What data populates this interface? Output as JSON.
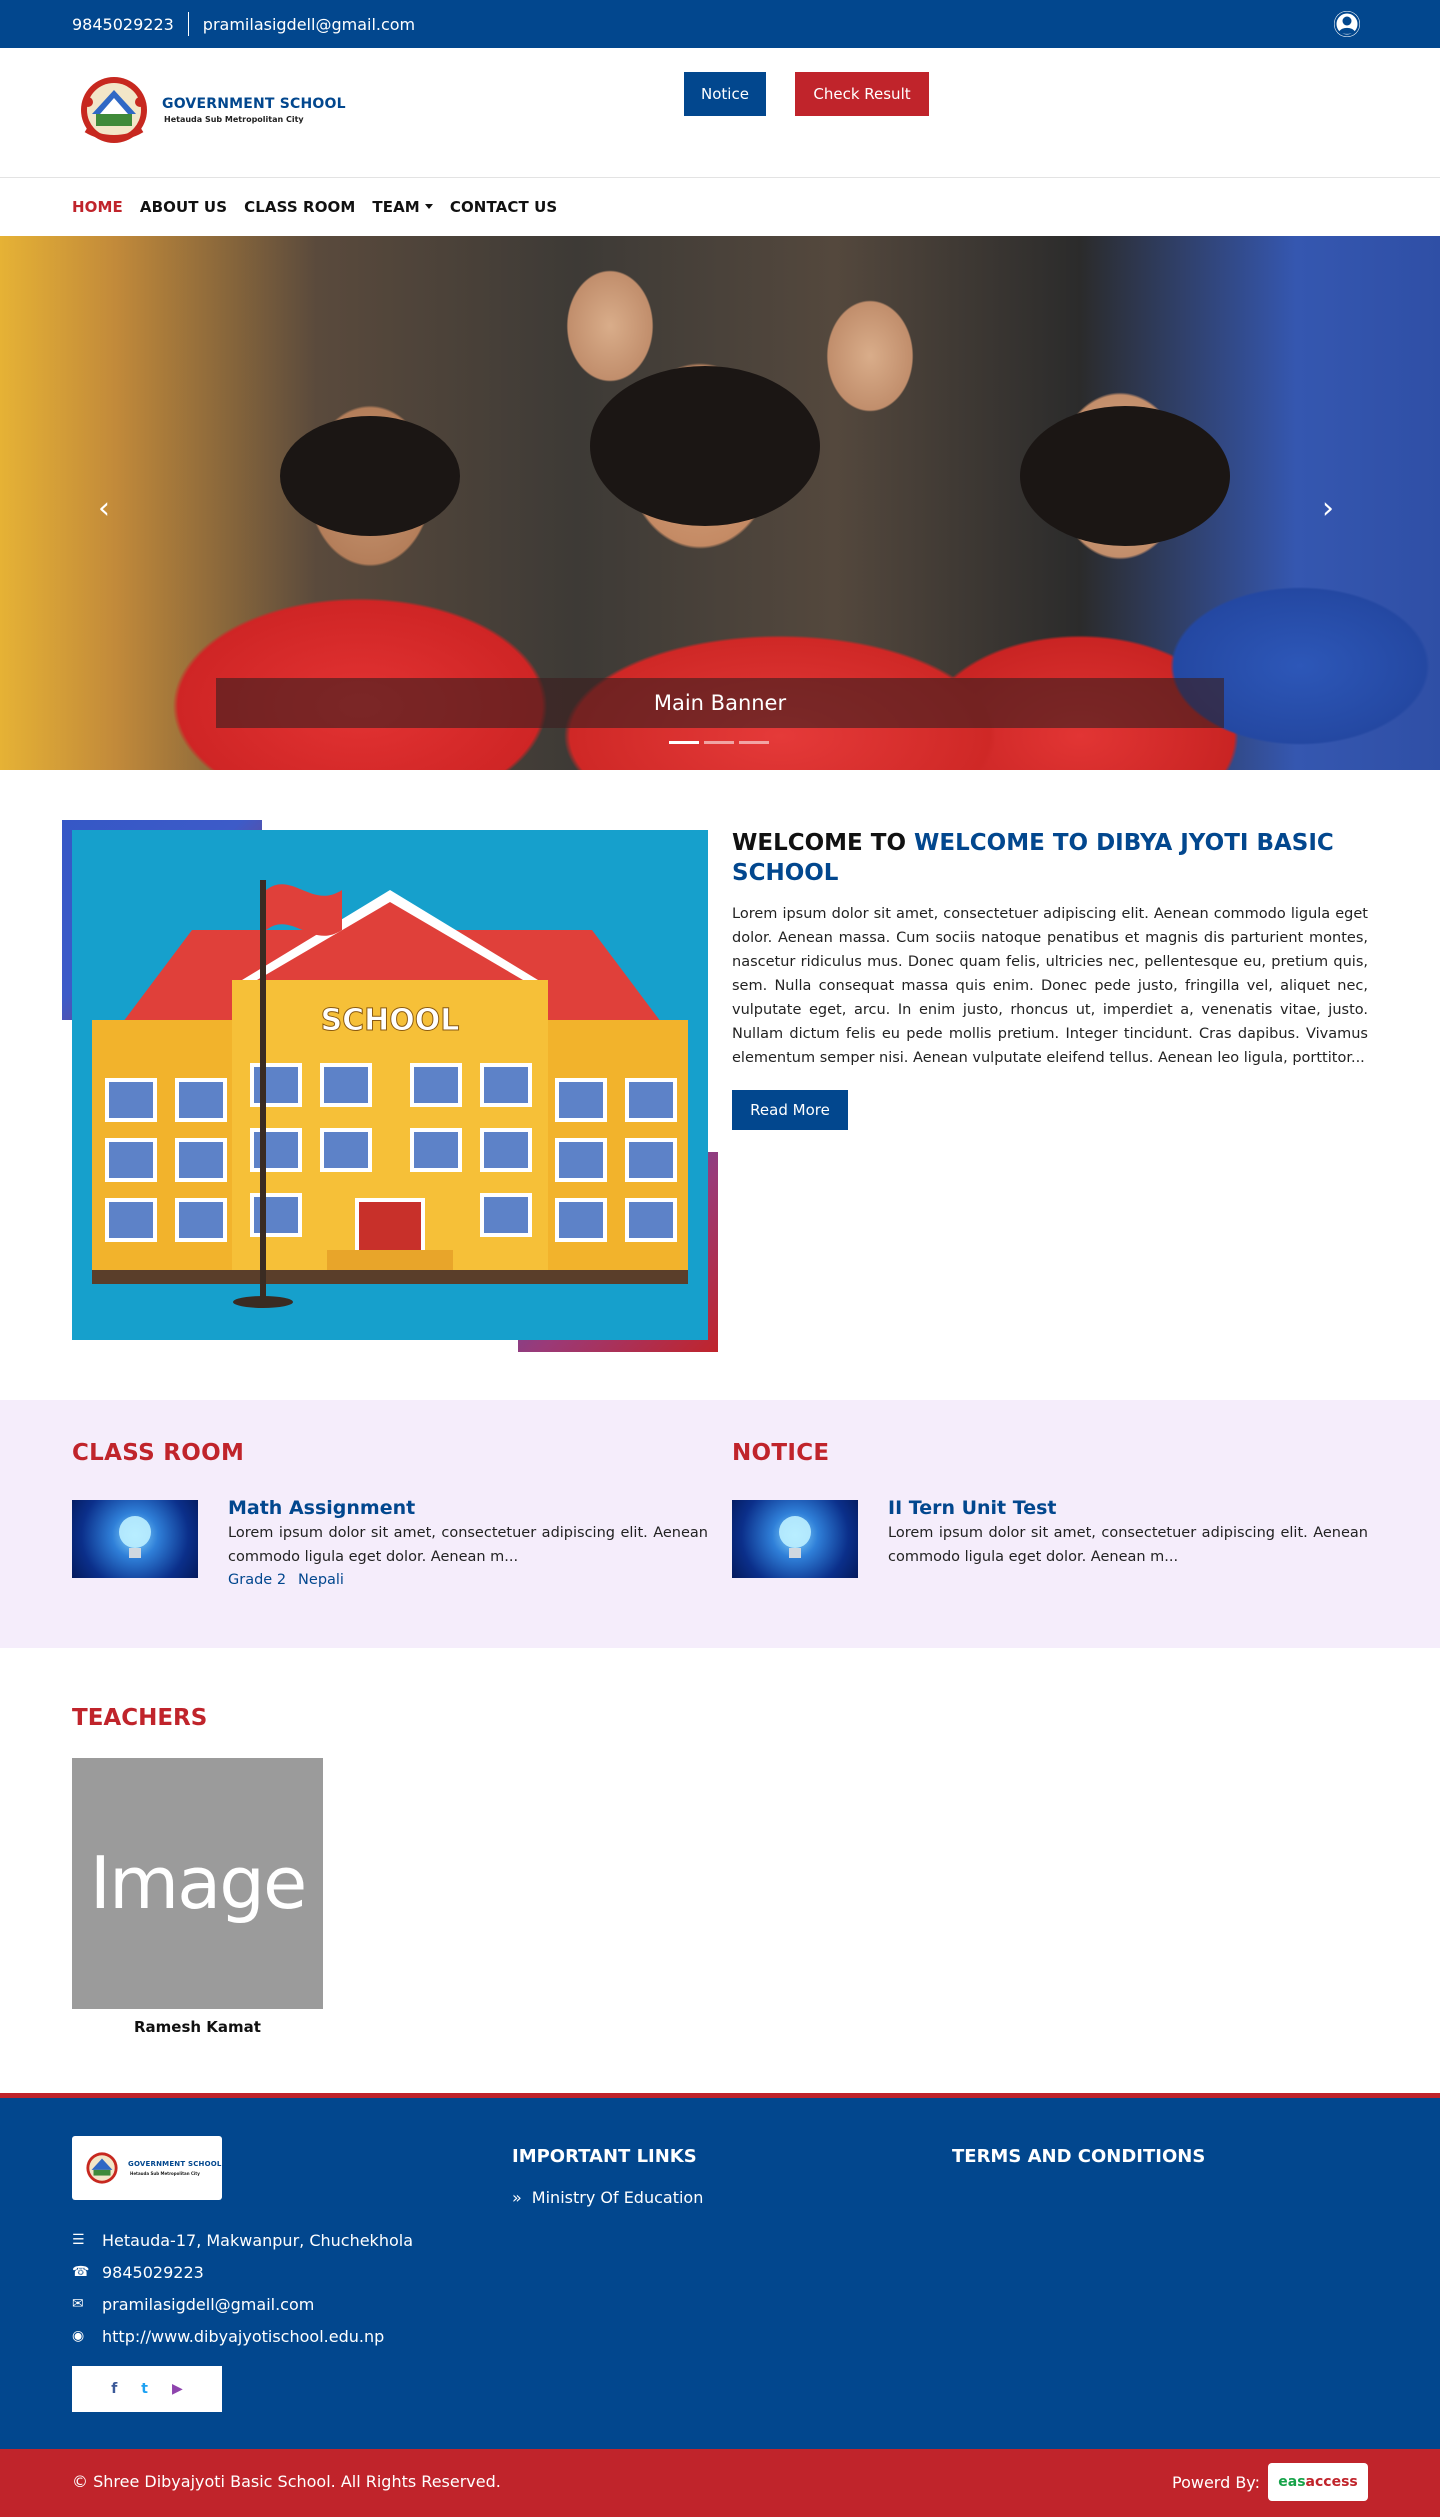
{
  "topbar": {
    "phone": "9845029223",
    "email": "pramilasigdell@gmail.com"
  },
  "header": {
    "logo_title": "GOVERNMENT SCHOOL",
    "logo_subtitle": "Hetauda Sub Metropolitan City",
    "notice_button": "Notice",
    "check_result_button": "Check Result"
  },
  "nav": {
    "items": [
      "HOME",
      "ABOUT US",
      "CLASS ROOM",
      "TEAM",
      "CONTACT US"
    ]
  },
  "banner": {
    "caption": "Main Banner"
  },
  "welcome": {
    "title_prefix": "WELCOME TO",
    "title_highlight": "WELCOME TO DIBYA JYOTI BASIC SCHOOL",
    "image_label": "SCHOOL",
    "body": "Lorem ipsum dolor sit amet, consectetuer adipiscing elit. Aenean commodo ligula eget dolor. Aenean massa. Cum sociis natoque penatibus et magnis dis parturient montes, nascetur ridiculus mus. Donec quam felis, ultricies nec, pellentesque eu, pretium quis, sem. Nulla consequat massa quis enim. Donec pede justo, fringilla vel, aliquet nec, vulputate eget, arcu. In enim justo, rhoncus ut, imperdiet a, venenatis vitae, justo. Nullam dictum felis eu pede mollis pretium. Integer tincidunt. Cras dapibus. Vivamus elementum semper nisi. Aenean vulputate eleifend tellus. Aenean leo ligula, porttitor...",
    "read_more": "Read More"
  },
  "classroom": {
    "heading": "CLASS ROOM",
    "item": {
      "title": "Math Assignment",
      "desc": "Lorem ipsum dolor sit amet, consectetuer adipiscing elit. Aenean commodo ligula eget dolor. Aenean m...",
      "grade": "Grade 2",
      "subject": "Nepali"
    }
  },
  "notice": {
    "heading": "NOTICE",
    "item": {
      "title": "II Tern Unit Test",
      "desc": "Lorem ipsum dolor sit amet, consectetuer adipiscing elit. Aenean commodo ligula eget dolor. Aenean m..."
    }
  },
  "teachers": {
    "heading": "TEACHERS",
    "placeholder": "Image",
    "items": [
      {
        "name": "Ramesh Kamat"
      }
    ]
  },
  "footer": {
    "address": "Hetauda-17, Makwanpur, Chuchekhola",
    "phone": "9845029223",
    "email": "pramilasigdell@gmail.com",
    "website": "http://www.dibyajyotischool.edu.np",
    "important_links_heading": "IMPORTANT LINKS",
    "links": [
      "Ministry Of Education"
    ],
    "terms_heading": "TERMS AND CONDITIONS",
    "social": {
      "facebook": "f",
      "twitter": "t",
      "youtube": "▶"
    },
    "social_icons": [
      "facebook-icon",
      "twitter-icon",
      "youtube-icon"
    ]
  },
  "copyright": {
    "text": "© Shree Dibyajyoti Basic School. All Rights Reserved.",
    "powered_by": "Powerd By:",
    "vendor_a": "eas",
    "vendor_b": "access"
  },
  "colors": {
    "primary": "#02478e",
    "accent": "#c0242b",
    "section_bg": "#f5edfb"
  }
}
